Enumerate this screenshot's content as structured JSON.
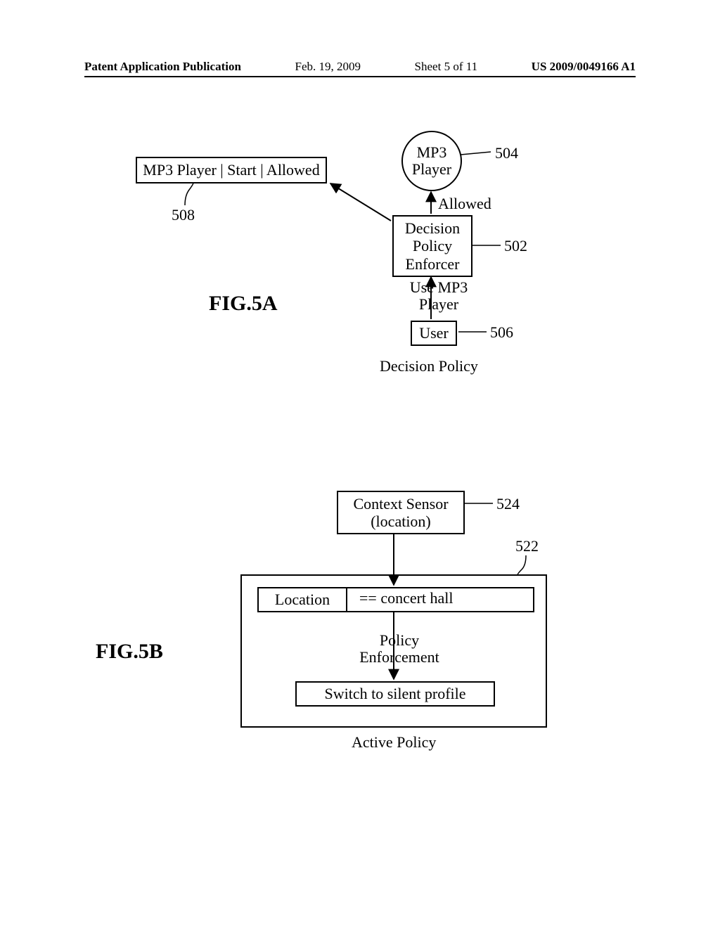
{
  "header": {
    "left": "Patent Application Publication",
    "date": "Feb. 19, 2009",
    "sheet": "Sheet 5 of 11",
    "pubno": "US 2009/0049166 A1"
  },
  "fig5a": {
    "label": "FIG.5A",
    "caption": "Decision Policy",
    "mp3_circle_l1": "MP3",
    "mp3_circle_l2": "Player",
    "allowed": "Allowed",
    "enforcer_l1": "Decision",
    "enforcer_l2": "Policy",
    "enforcer_l3": "Enforcer",
    "use_l1": "Use MP3",
    "use_l2": "Player",
    "user": "User",
    "rule": "MP3 Player | Start | Allowed",
    "ref504": "504",
    "ref502": "502",
    "ref506": "506",
    "ref508": "508"
  },
  "fig5b": {
    "label": "FIG.5B",
    "caption": "Active Policy",
    "sensor_l1": "Context Sensor",
    "sensor_l2": "(location)",
    "location": "Location",
    "eq": "== concert hall",
    "enforce_l1": "Policy",
    "enforce_l2": "Enforcement",
    "switch": "Switch to silent profile",
    "ref524": "524",
    "ref522": "522"
  }
}
